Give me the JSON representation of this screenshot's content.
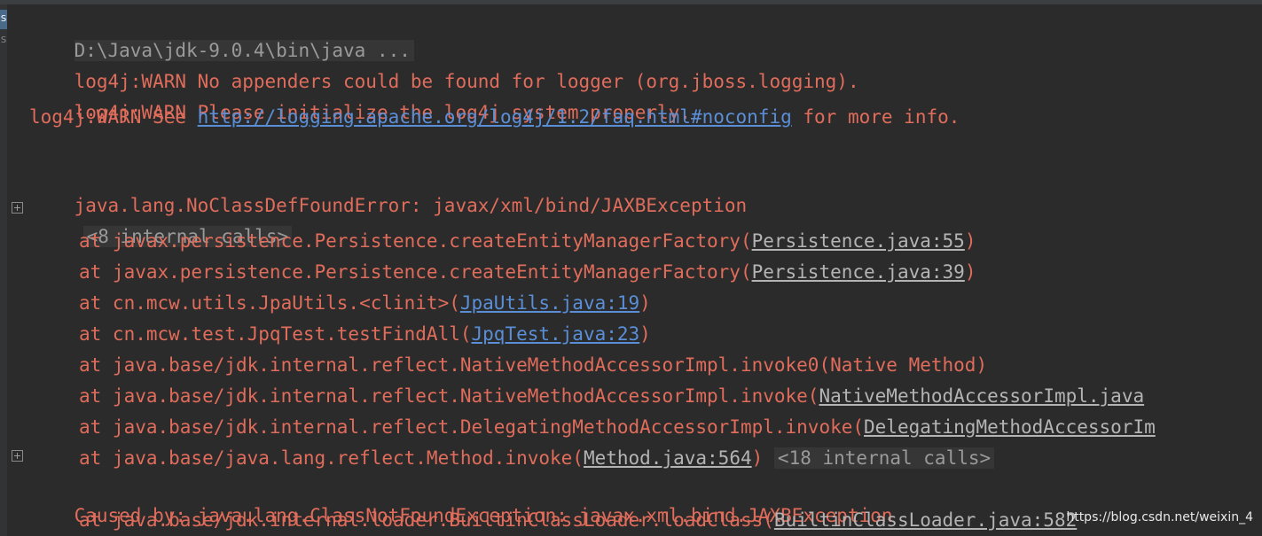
{
  "sidebar": {
    "tab_1": "S",
    "tab_2": "S"
  },
  "console": {
    "command": "D:\\Java\\jdk-9.0.4\\bin\\java ...",
    "warn_1": "log4j:WARN No appenders could be found for logger (org.jboss.logging).",
    "warn_2": "log4j:WARN Please initialize the log4j system properly.",
    "warn_3_prefix": "log4j:WARN See ",
    "warn_3_link": "http://logging.apache.org/log4j/1.2/faq.html#noconfig",
    "warn_3_suffix": " for more info.",
    "error_line": "java.lang.NoClassDefFoundError: javax/xml/bind/JAXBException",
    "internal_calls_1": "<8 internal calls>",
    "frames": [
      {
        "prefix": "at javax.persistence.Persistence.createEntityManagerFactory(",
        "source": "Persistence.java:55",
        "suffix": ")"
      },
      {
        "prefix": "at javax.persistence.Persistence.createEntityManagerFactory(",
        "source": "Persistence.java:39",
        "suffix": ")"
      },
      {
        "prefix": "at cn.mcw.utils.JpaUtils.<clinit>(",
        "source": "JpaUtils.java:19",
        "suffix": ")"
      },
      {
        "prefix": "at cn.mcw.test.JpqTest.testFindAll(",
        "source": "JpqTest.java:23",
        "suffix": ")"
      },
      {
        "prefix": "at java.base/jdk.internal.reflect.NativeMethodAccessorImpl.invoke0(Native Method)",
        "source": "",
        "suffix": ""
      },
      {
        "prefix": "at java.base/jdk.internal.reflect.NativeMethodAccessorImpl.invoke(",
        "source": "NativeMethodAccessorImpl.java",
        "suffix": ""
      },
      {
        "prefix": "at java.base/jdk.internal.reflect.DelegatingMethodAccessorImpl.invoke(",
        "source": "DelegatingMethodAccessorIm",
        "suffix": ""
      },
      {
        "prefix": "at java.base/java.lang.reflect.Method.invoke(",
        "source": "Method.java:564",
        "suffix": ")"
      }
    ],
    "internal_calls_2": "<18 internal calls>",
    "caused_by": "Caused by: java.lang.ClassNotFoundException: javax.xml.bind.JAXBException",
    "last_frame_prefix": "at java.base/jdk.internal.loader.BuiltinClassLoader.loadClass(",
    "last_frame_source": "BuiltinClassLoader.java:582"
  },
  "watermark": "https://blog.csdn.net/weixin_4",
  "colors": {
    "background": "#2b2b2b",
    "error_text": "#e06c5b",
    "link": "#5a8fd8",
    "muted": "#9a9a9a"
  }
}
